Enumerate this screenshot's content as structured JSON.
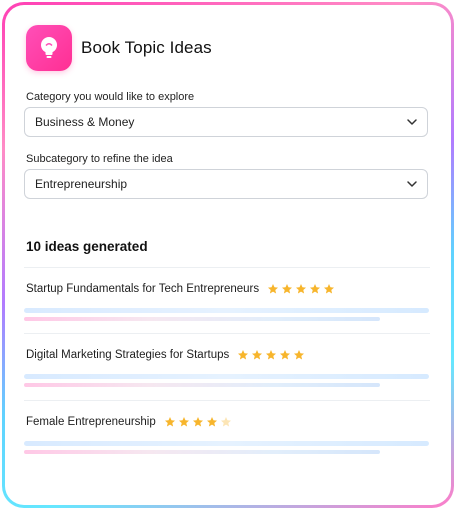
{
  "app": {
    "title": "Book Topic Ideas",
    "icon": "lightbulb-icon",
    "accent_color": "#ff3fa0"
  },
  "form": {
    "category": {
      "label": "Category you would like to explore",
      "value": "Business & Money"
    },
    "subcategory": {
      "label": "Subcategory to refine the idea",
      "value": "Entrepreneurship"
    }
  },
  "results": {
    "heading": "10 ideas generated",
    "star_color": "#f7b52c",
    "items": [
      {
        "title": "Startup Fundamentals for Tech Entrepreneurs",
        "rating": 5
      },
      {
        "title": "Digital Marketing Strategies for Startups",
        "rating": 5
      },
      {
        "title": "Female Entrepreneurship",
        "rating": 4
      }
    ]
  }
}
